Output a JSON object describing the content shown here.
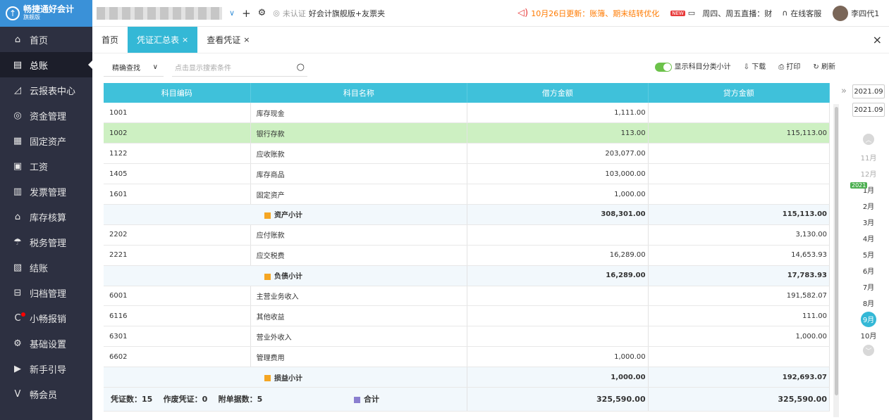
{
  "brand": {
    "name": "畅捷通好会计",
    "edition": "旗舰版"
  },
  "sidebar": {
    "items": [
      {
        "label": "首页",
        "icon": "home-icon",
        "glyph": "⌂"
      },
      {
        "label": "总账",
        "icon": "ledger-icon",
        "glyph": "▤"
      },
      {
        "label": "云报表中心",
        "icon": "chart-icon",
        "glyph": "◿"
      },
      {
        "label": "资金管理",
        "icon": "money-icon",
        "glyph": "◎"
      },
      {
        "label": "固定资产",
        "icon": "asset-icon",
        "glyph": "▦"
      },
      {
        "label": "工资",
        "icon": "salary-icon",
        "glyph": "▣"
      },
      {
        "label": "发票管理",
        "icon": "invoice-icon",
        "glyph": "▥"
      },
      {
        "label": "库存核算",
        "icon": "inventory-icon",
        "glyph": "⌂"
      },
      {
        "label": "税务管理",
        "icon": "tax-icon",
        "glyph": "☂"
      },
      {
        "label": "结账",
        "icon": "checkout-icon",
        "glyph": "▧"
      },
      {
        "label": "归档管理",
        "icon": "archive-icon",
        "glyph": "⊟"
      },
      {
        "label": "小畅报销",
        "icon": "reimburse-icon",
        "glyph": "C"
      },
      {
        "label": "基础设置",
        "icon": "settings-icon",
        "glyph": "⚙"
      },
      {
        "label": "新手引导",
        "icon": "guide-icon",
        "glyph": "▶"
      },
      {
        "label": "畅会员",
        "icon": "member-icon",
        "glyph": "V"
      }
    ]
  },
  "topbar": {
    "add_symbol": "+",
    "settings_symbol": "⚙",
    "cert_status": "未认证",
    "edition_text": "好会计旗舰版+友票夹",
    "notice": "10月26日更新：账簿、期末结转优化",
    "live_badge": "NEW",
    "live_text": "周四、周五直播：财",
    "service": "在线客服",
    "user": "李四代1"
  },
  "tabs": [
    {
      "label": "首页",
      "closable": false
    },
    {
      "label": "凭证汇总表",
      "closable": true
    },
    {
      "label": "查看凭证",
      "closable": true
    }
  ],
  "close_symbol": "×",
  "toolbar": {
    "search_mode": "精确查找",
    "search_placeholder": "点击显示搜索条件",
    "toggle_label": "显示科目分类小计",
    "download": "下载",
    "print": "打印",
    "refresh": "刷新"
  },
  "table": {
    "headers": [
      "科目编码",
      "科目名称",
      "借方金额",
      "贷方金额"
    ],
    "rows": [
      {
        "code": "1001",
        "name": "库存现金",
        "debit": "1,111.00",
        "credit": ""
      },
      {
        "code": "1002",
        "name": "银行存款",
        "debit": "113.00",
        "credit": "115,113.00"
      },
      {
        "code": "1122",
        "name": "应收账款",
        "debit": "203,077.00",
        "credit": ""
      },
      {
        "code": "1405",
        "name": "库存商品",
        "debit": "103,000.00",
        "credit": ""
      },
      {
        "code": "1601",
        "name": "固定资产",
        "debit": "1,000.00",
        "credit": ""
      },
      {
        "subtotal": "资产小计",
        "debit": "308,301.00",
        "credit": "115,113.00"
      },
      {
        "code": "2202",
        "name": "应付账款",
        "debit": "",
        "credit": "3,130.00"
      },
      {
        "code": "2221",
        "name": "应交税费",
        "debit": "16,289.00",
        "credit": "14,653.93"
      },
      {
        "subtotal": "负债小计",
        "debit": "16,289.00",
        "credit": "17,783.93"
      },
      {
        "code": "6001",
        "name": "主营业务收入",
        "debit": "",
        "credit": "191,582.07"
      },
      {
        "code": "6116",
        "name": "其他收益",
        "debit": "",
        "credit": "111.00"
      },
      {
        "code": "6301",
        "name": "营业外收入",
        "debit": "",
        "credit": "1,000.00"
      },
      {
        "code": "6602",
        "name": "管理费用",
        "debit": "1,000.00",
        "credit": ""
      },
      {
        "subtotal": "损益小计",
        "debit": "1,000.00",
        "credit": "192,693.07"
      }
    ],
    "footer": {
      "voucher_count": "凭证数：15",
      "void_count": "作废凭证：0",
      "attach_count": "附单据数：5",
      "total_label": "合计",
      "debit_total": "325,590.00",
      "credit_total": "325,590.00"
    }
  },
  "panel": {
    "date_from": "2021.09",
    "date_to": "2021.09",
    "year_badge": "2021",
    "months": [
      "11月",
      "12月",
      "1月",
      "2月",
      "3月",
      "4月",
      "5月",
      "6月",
      "7月",
      "8月",
      "9月",
      "10月"
    ],
    "selected_month": "9月"
  },
  "colors": {
    "accent": "#34b8d6",
    "header": "#3fc1da",
    "sidebar": "#2d3041",
    "highlight": "#cdf0c2",
    "toggle": "#6cc24a"
  }
}
